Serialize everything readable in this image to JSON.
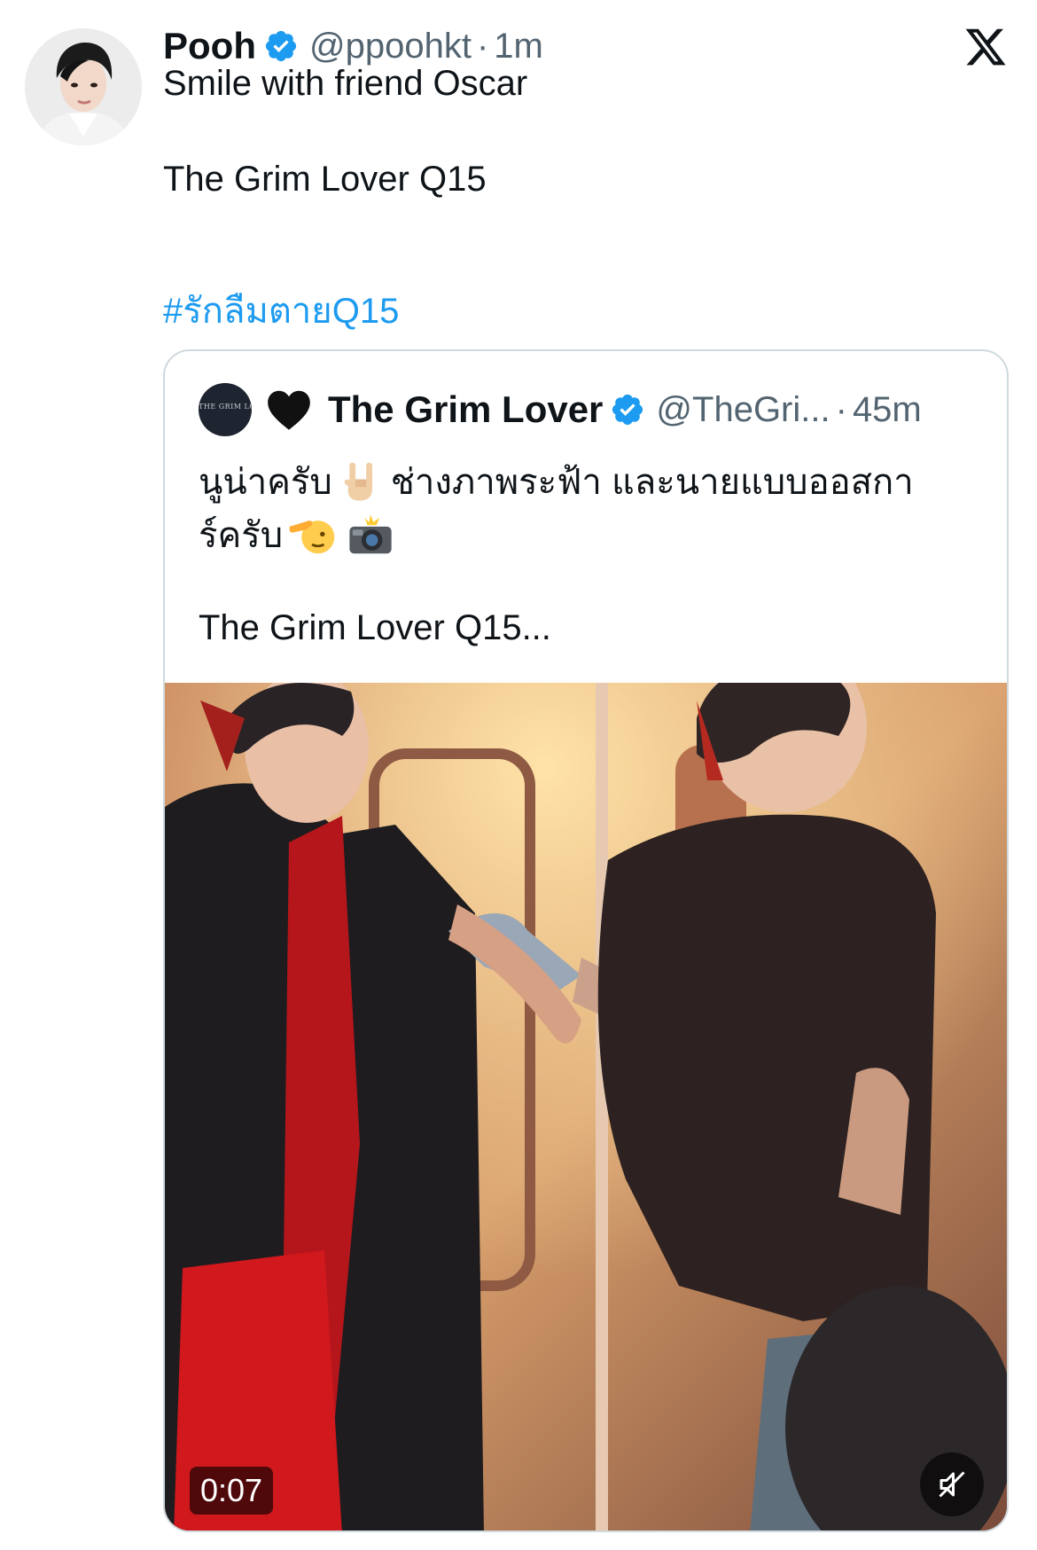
{
  "tweet": {
    "author": {
      "display_name": "Pooh",
      "handle": "@ppoohkt",
      "separator": "·",
      "time": "1m",
      "verified": true,
      "avatar_icon": "profile-avatar"
    },
    "brand_icon": "x-logo-icon",
    "text_line1": "Smile with friend Oscar",
    "text_line2": "The Grim Lover Q15",
    "hashtag": "#รักลืมตายQ15",
    "link_color": "#1d9bf0",
    "verified_color": "#1d9bf0"
  },
  "quote": {
    "avatar_text": "THE GRIM LOVER",
    "heart_icon": "black-heart-emoji",
    "display_name": "The Grim Lover",
    "handle": "@TheGri...",
    "separator": "·",
    "time": "45m",
    "verified": true,
    "text_line1_a": "นูน่าครับ",
    "text_line1_b": "ช่างภาพระฟ้า และนายแบบออสกา",
    "text_line2": "ร์ครับ",
    "emojis": [
      "sign-of-the-horns-emoji",
      "saluting-hand-emoji",
      "camera-with-flash-emoji"
    ],
    "text_line3": "The Grim Lover Q15...",
    "video": {
      "duration": "0:07",
      "muted": true
    }
  }
}
